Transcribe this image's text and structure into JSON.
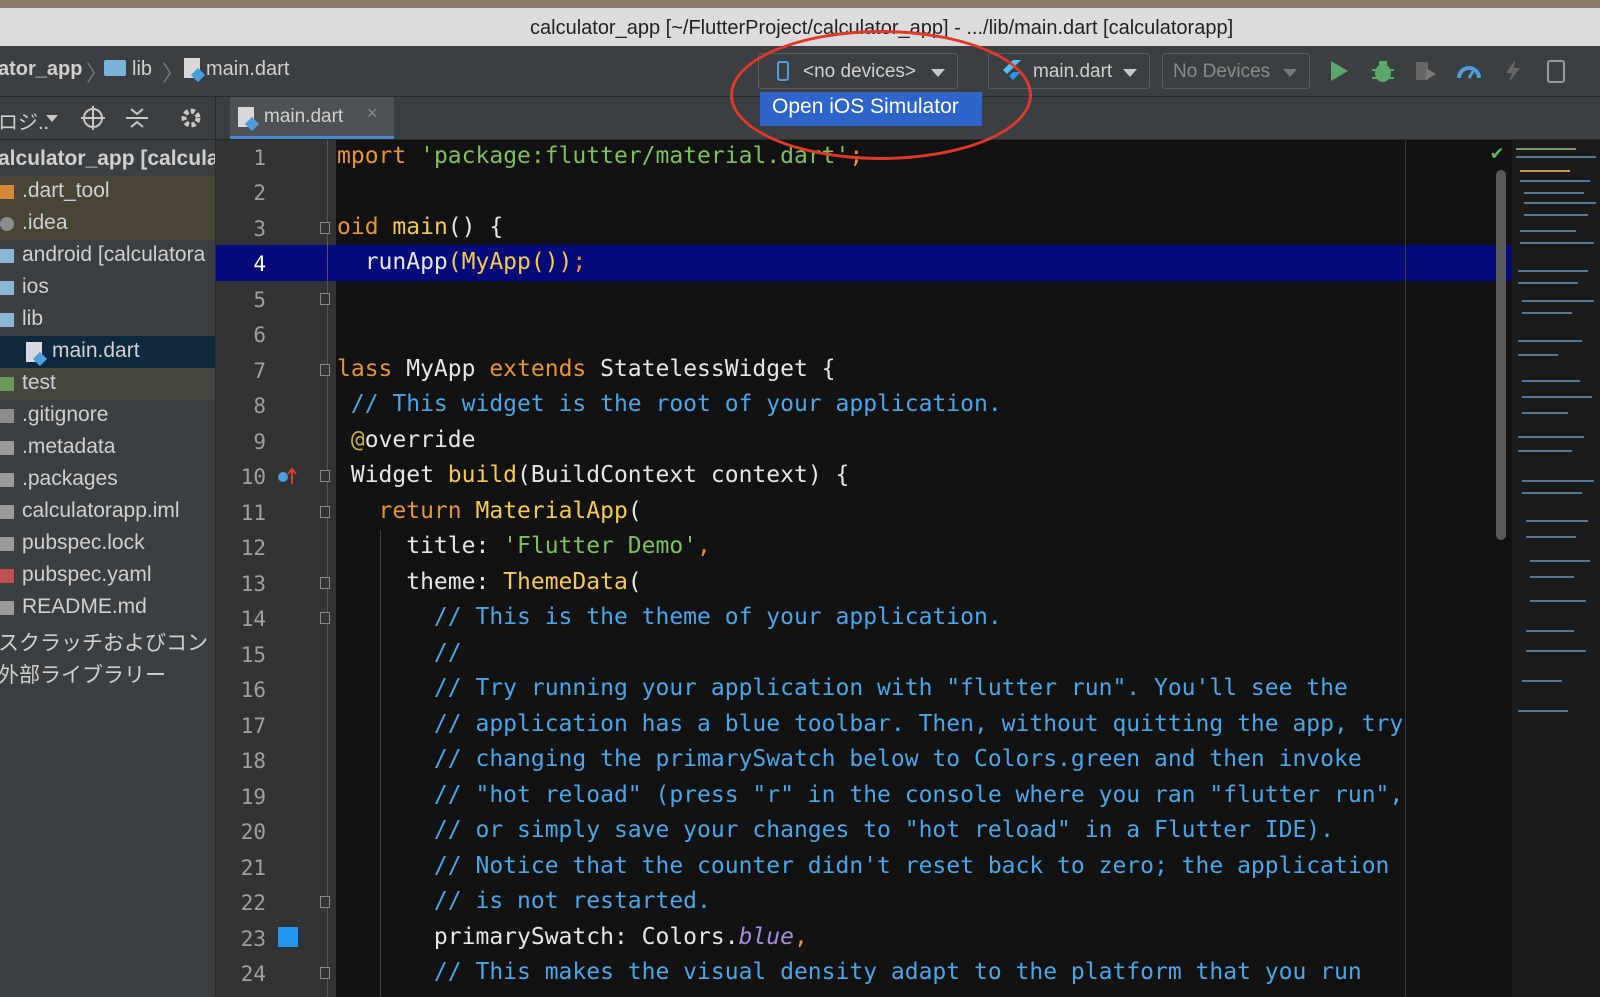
{
  "window": {
    "title": "calculator_app [~/FlutterProject/calculator_app] - .../lib/main.dart [calculatorapp]"
  },
  "navbar": {
    "breadcrumbs": [
      "ator_app",
      "lib",
      "main.dart"
    ],
    "device_selector": "<no devices>",
    "run_config": "main.dart",
    "devices_combo": "No Devices"
  },
  "popup": {
    "label": "Open iOS Simulator"
  },
  "sidebar": {
    "view_label": "ロジ..",
    "tree": [
      {
        "label": "alculator_app [calcula",
        "bold": true
      },
      {
        "label": ".dart_tool"
      },
      {
        "label": ".idea"
      },
      {
        "label": "android [calculatora"
      },
      {
        "label": "ios"
      },
      {
        "label": "lib"
      },
      {
        "label": "main.dart"
      },
      {
        "label": "test"
      },
      {
        "label": ".gitignore"
      },
      {
        "label": ".metadata"
      },
      {
        "label": ".packages"
      },
      {
        "label": "calculatorapp.iml"
      },
      {
        "label": "pubspec.lock"
      },
      {
        "label": "pubspec.yaml"
      },
      {
        "label": "README.md"
      },
      {
        "label": "スクラッチおよびコン"
      },
      {
        "label": "外部ライブラリー"
      }
    ]
  },
  "editor": {
    "tab_label": "main.dart",
    "tab_close": "×",
    "status_check": "✔",
    "current_line": 4,
    "line_numbers": [
      "1",
      "2",
      "3",
      "4",
      "5",
      "6",
      "7",
      "8",
      "9",
      "10",
      "11",
      "12",
      "13",
      "14",
      "15",
      "16",
      "17",
      "18",
      "19",
      "20",
      "21",
      "22",
      "23",
      "24"
    ],
    "lines": [
      "mport 'package:flutter/material.dart';",
      "",
      "oid main() {",
      " runApp(MyApp());",
      "",
      "",
      "lass MyApp extends StatelessWidget {",
      " // This widget is the root of your application.",
      " @override",
      " Widget build(BuildContext context) {",
      "   return MaterialApp(",
      "     title: 'Flutter Demo',",
      "     theme: ThemeData(",
      "       // This is the theme of your application.",
      "       //",
      "       // Try running your application with \"flutter run\". You'll see the",
      "       // application has a blue toolbar. Then, without quitting the app, try",
      "       // changing the primarySwatch below to Colors.green and then invoke",
      "       // \"hot reload\" (press \"r\" in the console where you ran \"flutter run\",",
      "       // or simply save your changes to \"hot reload\" in a Flutter IDE).",
      "       // Notice that the counter didn't reset back to zero; the application",
      "       // is not restarted.",
      "       primarySwatch: Colors.blue,",
      "       // This makes the visual density adapt to the platform that you run"
    ]
  },
  "colors": {
    "accent_blue": "#2f65ca",
    "annotation_red": "#e0392a",
    "current_line": "#040a7a"
  }
}
